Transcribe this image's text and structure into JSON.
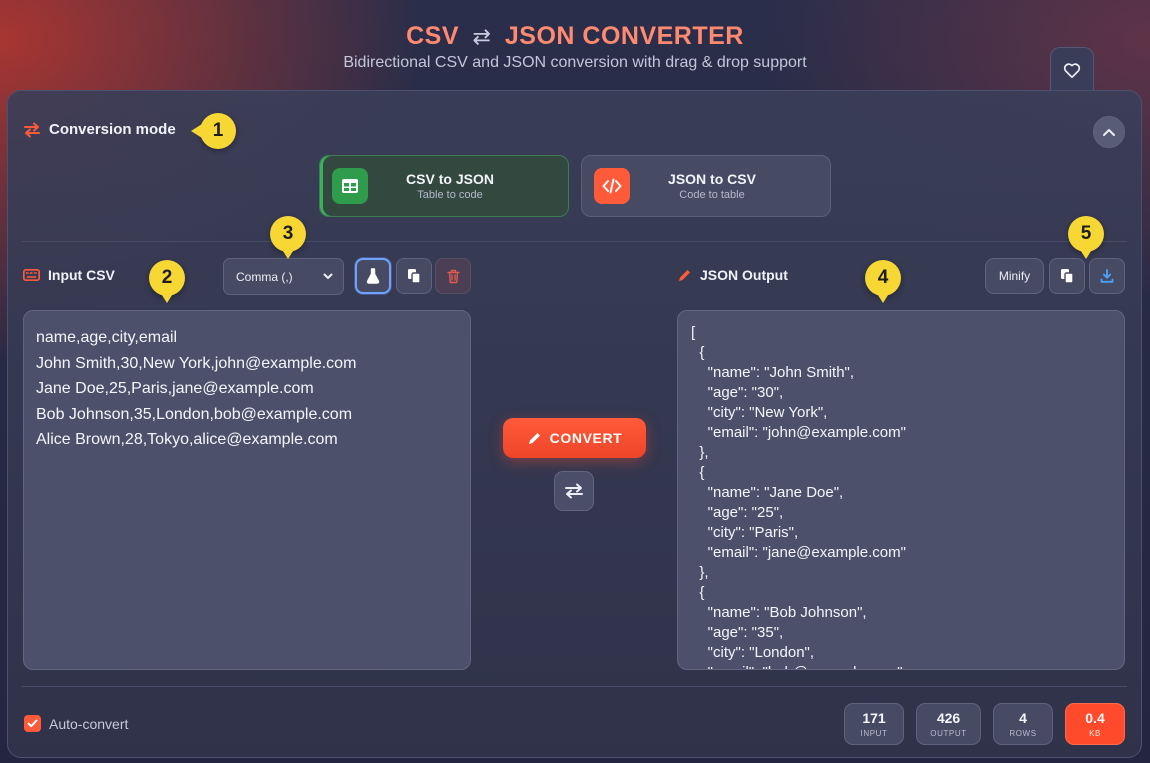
{
  "header": {
    "title_left": "CSV",
    "title_arrow": "⇄",
    "title_right": "JSON CONVERTER",
    "subtitle": "Bidirectional CSV and JSON conversion with drag & drop support"
  },
  "conversion_mode": {
    "label": "Conversion mode",
    "options": [
      {
        "title": "CSV to JSON",
        "subtitle": "Table to code",
        "active": true
      },
      {
        "title": "JSON to CSV",
        "subtitle": "Code to table",
        "active": false
      }
    ]
  },
  "input": {
    "label": "Input CSV",
    "delimiter_selected": "Comma (,)",
    "lines": [
      "name,age,city,email",
      "John Smith,30,New York,john@example.com",
      "Jane Doe,25,Paris,jane@example.com",
      "Bob Johnson,35,London,bob@example.com",
      "Alice Brown,28,Tokyo,alice@example.com"
    ]
  },
  "actions": {
    "convert_label": "CONVERT"
  },
  "output": {
    "label": "JSON Output",
    "minify_label": "Minify",
    "text": "[\n  {\n    \"name\": \"John Smith\",\n    \"age\": \"30\",\n    \"city\": \"New York\",\n    \"email\": \"john@example.com\"\n  },\n  {\n    \"name\": \"Jane Doe\",\n    \"age\": \"25\",\n    \"city\": \"Paris\",\n    \"email\": \"jane@example.com\"\n  },\n  {\n    \"name\": \"Bob Johnson\",\n    \"age\": \"35\",\n    \"city\": \"London\",\n    \"email\": \"bob@example.com\""
  },
  "footer": {
    "auto_convert_label": "Auto-convert",
    "auto_convert_checked": true,
    "stats": [
      {
        "value": "171",
        "label": "INPUT"
      },
      {
        "value": "426",
        "label": "OUTPUT"
      },
      {
        "value": "4",
        "label": "ROWS"
      },
      {
        "value": "0.4",
        "label": "KB"
      }
    ]
  },
  "callouts": [
    "1",
    "2",
    "3",
    "4",
    "5"
  ],
  "colors": {
    "accent": "#ff5a3a",
    "title": "#ff8a70",
    "success": "#39b35a",
    "callout": "#f6d733"
  },
  "icons": {
    "favorite": "heart-icon",
    "mode": "arrows-swap-icon",
    "collapse": "chevron-up-icon",
    "csv_to_json": "table-icon",
    "json_to_csv": "code-icon",
    "input": "keyboard-icon",
    "sample": "flask-icon",
    "paste": "paste-icon",
    "clear": "trash-icon",
    "output": "pencil-icon",
    "copy": "copy-icon",
    "download": "download-icon",
    "swap": "swap-direction-icon"
  }
}
